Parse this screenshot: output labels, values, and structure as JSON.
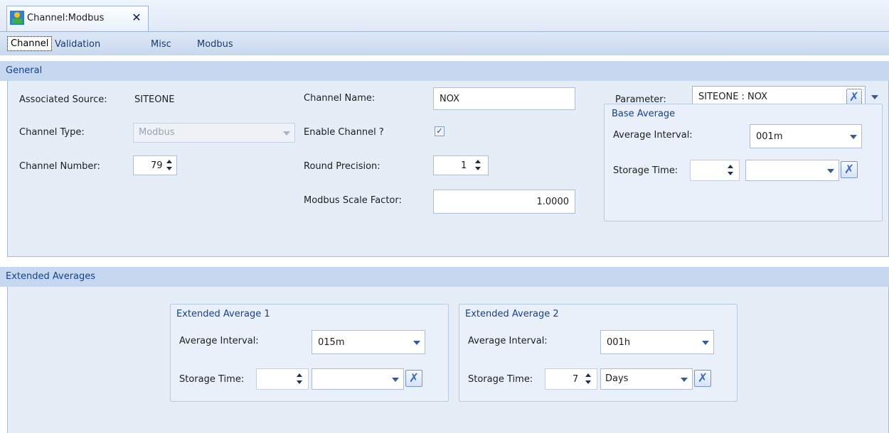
{
  "document_tab": {
    "title": "Channel:Modbus",
    "close_glyph": "✕",
    "icon": "channel-icon"
  },
  "tabs": [
    {
      "label": "Channel"
    },
    {
      "label": "Validation"
    },
    {
      "label": "Misc"
    },
    {
      "label": "Modbus"
    }
  ],
  "general": {
    "title": "General",
    "associated_source_label": "Associated Source:",
    "associated_source_value": "SITEONE",
    "channel_type_label": "Channel Type:",
    "channel_type_value": "Modbus",
    "channel_number_label": "Channel Number:",
    "channel_number_value": "79",
    "channel_name_label": "Channel Name:",
    "channel_name_value": "NOX",
    "enable_channel_label": "Enable Channel ?",
    "enable_channel_checked": true,
    "check_glyph": "✓",
    "round_precision_label": "Round Precision:",
    "round_precision_value": "1",
    "modbus_scale_factor_label": "Modbus Scale Factor:",
    "modbus_scale_factor_value": "1.0000",
    "parameter_label": "Parameter:",
    "parameter_value": "SITEONE : NOX",
    "base_average": {
      "title": "Base Average",
      "average_interval_label": "Average Interval:",
      "average_interval_value": "001m",
      "storage_time_label": "Storage Time:",
      "storage_time_value": "",
      "storage_unit_value": ""
    }
  },
  "extended": {
    "title": "Extended Averages",
    "avg1": {
      "title": "Extended Average 1",
      "average_interval_label": "Average Interval:",
      "average_interval_value": "015m",
      "storage_time_label": "Storage Time:",
      "storage_time_value": "",
      "storage_unit_value": ""
    },
    "avg2": {
      "title": "Extended Average 2",
      "average_interval_label": "Average Interval:",
      "average_interval_value": "001h",
      "storage_time_label": "Storage Time:",
      "storage_time_value": "7",
      "storage_unit_value": "Days"
    }
  },
  "clear_glyph": "✗",
  "colors": {
    "header_bg": "#c5d8ef",
    "panel_bg": "#e5edf7",
    "title_blue": "#15428b"
  }
}
